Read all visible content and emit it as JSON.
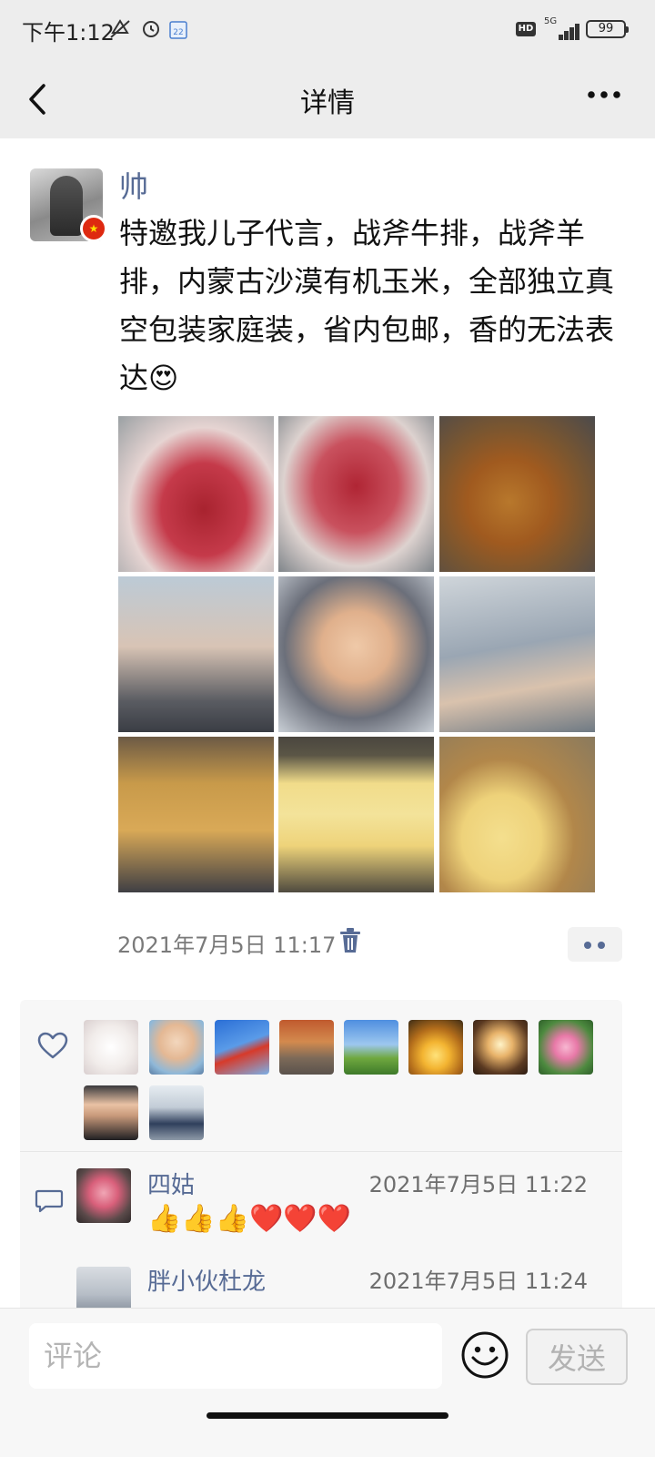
{
  "status_bar": {
    "time": "下午1:12",
    "network": "5G",
    "battery": "99"
  },
  "header": {
    "title": "详情",
    "back_icon": "back-icon",
    "more_icon": "more-icon"
  },
  "post": {
    "author": "帅",
    "text": "特邀我儿子代言，战斧牛排，战斧羊排，内蒙古沙漠有机玉米，全部独立真空包装家庭装，省内包邮，香的无法表达😍",
    "timestamp": "2021年7月5日 11:17",
    "photos": [
      "photo-steak-hand",
      "photo-steaks-table",
      "photo-cooked-steak",
      "photo-boy-flour",
      "photo-boy-smiling",
      "photo-two-boys",
      "photo-baked-tray",
      "photo-corn-cobs",
      "photo-corn-steamer"
    ],
    "delete_icon": "trash-icon",
    "actions_icon": "dots-icon"
  },
  "likes": {
    "count": 10
  },
  "comments": [
    {
      "name": "四姑",
      "time": "2021年7月5日 11:22",
      "text": "👍👍👍❤️❤️❤️"
    },
    {
      "name": "胖小伙杜龙",
      "time": "2021年7月5日 11:24"
    }
  ],
  "bottom_bar": {
    "placeholder": "评论",
    "send_label": "发送"
  },
  "colors": {
    "link": "#576b95",
    "background": "#ededed"
  }
}
